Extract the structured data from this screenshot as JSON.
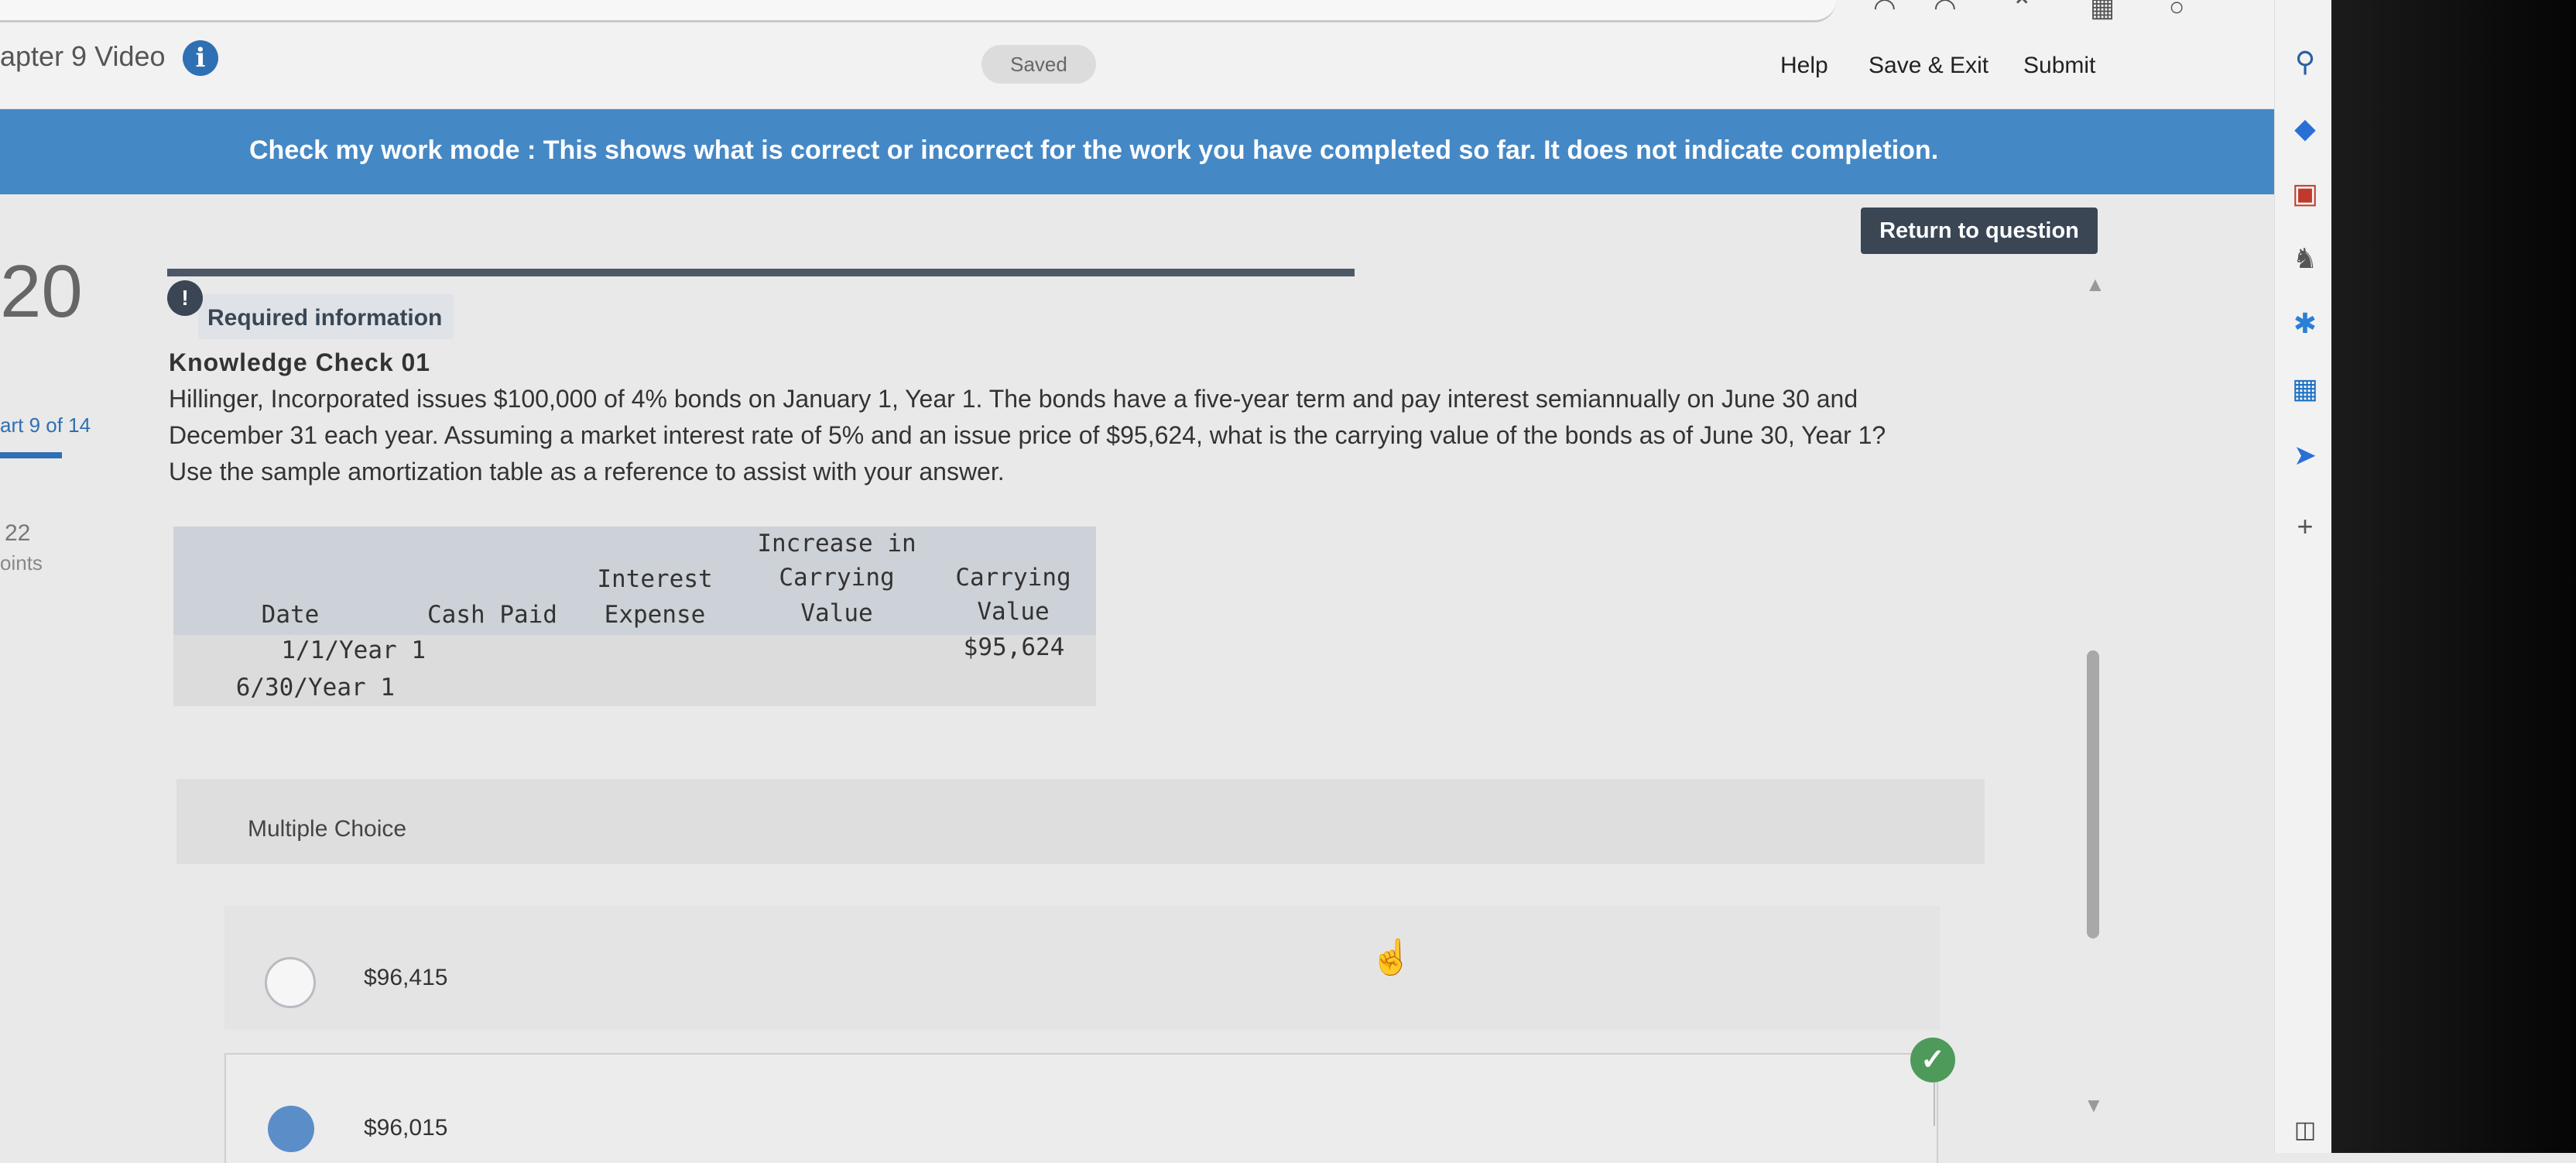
{
  "header": {
    "chapter_title": "apter 9 Video",
    "saved": "Saved",
    "links": {
      "help": "Help",
      "save_exit": "Save & Exit",
      "submit": "Submit"
    }
  },
  "banner": {
    "text": "Check my work mode : This shows what is correct or incorrect for the work you have completed so far. It does not indicate completion."
  },
  "left_rail": {
    "question_number": "20",
    "part_label": "art 9",
    "part_of": "of 14",
    "points_value": "22",
    "points_label": "oints"
  },
  "return_button": "Return to question",
  "required_info": {
    "icon": "!",
    "label": "Required information"
  },
  "question": {
    "heading": "Knowledge Check 01",
    "line1": "Hillinger, Incorporated issues $100,000 of 4% bonds on January 1, Year 1. The bonds have a five-year term and pay interest semiannually on June 30 and",
    "line2": "December 31 each year. Assuming a market interest rate of 5% and an issue price of $95,624, what is the carrying value of the bonds as of June 30, Year 1?",
    "line3": "Use the sample amortization table as a reference to assist with your answer."
  },
  "amortization_table": {
    "headers": {
      "date": "Date",
      "cash_paid": "Cash Paid",
      "interest_1": "Interest",
      "interest_2": "Expense",
      "increase_1": "Increase in",
      "increase_2": "Carrying",
      "increase_3": "Value",
      "carrying_1": "Carrying",
      "carrying_2": "Value"
    },
    "rows": [
      {
        "date": "1/1/Year 1",
        "carrying_value": "$95,624"
      },
      {
        "date": "6/30/Year 1",
        "carrying_value": ""
      }
    ]
  },
  "multiple_choice": {
    "label": "Multiple Choice",
    "options": [
      {
        "text": "$96,415",
        "selected": false
      },
      {
        "text": "$96,015",
        "selected": true
      }
    ]
  },
  "sidebar_icons": [
    "search-icon",
    "tag-icon",
    "toolbox-icon",
    "chess-icon",
    "copilot-icon",
    "outlook-icon",
    "send-icon",
    "plus-icon",
    "panel-icon"
  ],
  "colors": {
    "banner": "#4588c6",
    "return_button": "#3a4654",
    "correct_check": "#4e9a5b",
    "selected_radio": "#5b8ec9"
  }
}
